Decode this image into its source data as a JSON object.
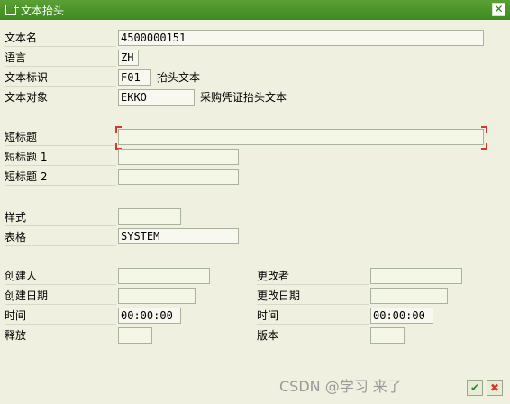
{
  "window": {
    "title": "文本抬头"
  },
  "fields": {
    "text_name": {
      "label": "文本名",
      "value": "4500000151"
    },
    "language": {
      "label": "语言",
      "value": "ZH"
    },
    "text_id": {
      "label": "文本标识",
      "value": "F01",
      "desc": "抬头文本"
    },
    "text_object": {
      "label": "文本对象",
      "value": "EKKO",
      "desc": "采购凭证抬头文本"
    },
    "short_title": {
      "label": "短标题",
      "value": ""
    },
    "short_title_1": {
      "label": "短标题 1",
      "value": ""
    },
    "short_title_2": {
      "label": "短标题 2",
      "value": ""
    },
    "style": {
      "label": "样式",
      "value": ""
    },
    "form": {
      "label": "表格",
      "value": "SYSTEM"
    },
    "created_by": {
      "label": "创建人",
      "value": ""
    },
    "created_date": {
      "label": "创建日期",
      "value": ""
    },
    "created_time": {
      "label": "时间",
      "value": "00:00:00"
    },
    "release": {
      "label": "释放",
      "value": ""
    },
    "changed_by": {
      "label": "更改者",
      "value": ""
    },
    "changed_date": {
      "label": "更改日期",
      "value": ""
    },
    "changed_time": {
      "label": "时间",
      "value": "00:00:00"
    },
    "version": {
      "label": "版本",
      "value": ""
    }
  },
  "footer": {
    "watermark": "CSDN @学习 来了",
    "confirm_icon": "check-icon",
    "cancel_icon": "cancel-icon"
  },
  "colors": {
    "title_bar": "#4a9a2a",
    "background": "#f0f0e0",
    "field": "#f5f7e6",
    "focus_bracket": "#d23b2c"
  }
}
